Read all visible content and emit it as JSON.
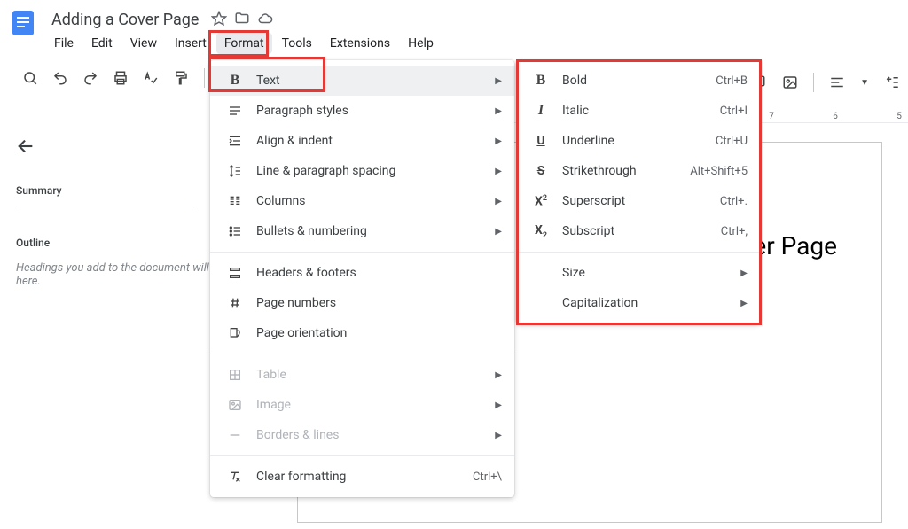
{
  "doc": {
    "title": "Adding a Cover Page"
  },
  "menubar": [
    "File",
    "Edit",
    "View",
    "Insert",
    "Format",
    "Tools",
    "Extensions",
    "Help"
  ],
  "ruler": {
    "labels": [
      "7",
      "6",
      "5"
    ]
  },
  "outline": {
    "summary_label": "Summary",
    "outline_label": "Outline",
    "help_text": "Headings you add to the document will appear here."
  },
  "page": {
    "visible_text": "ver Page"
  },
  "format_menu": {
    "text": "Text",
    "paragraph_styles": "Paragraph styles",
    "align_indent": "Align & indent",
    "line_spacing": "Line & paragraph spacing",
    "columns": "Columns",
    "bullets": "Bullets & numbering",
    "headers_footers": "Headers & footers",
    "page_numbers": "Page numbers",
    "page_orientation": "Page orientation",
    "table": "Table",
    "image": "Image",
    "borders_lines": "Borders & lines",
    "clear_formatting": "Clear formatting",
    "clear_shortcut": "Ctrl+\\"
  },
  "text_menu": {
    "bold": {
      "label": "Bold",
      "shortcut": "Ctrl+B"
    },
    "italic": {
      "label": "Italic",
      "shortcut": "Ctrl+I"
    },
    "underline": {
      "label": "Underline",
      "shortcut": "Ctrl+U"
    },
    "strike": {
      "label": "Strikethrough",
      "shortcut": "Alt+Shift+5"
    },
    "superscript": {
      "label": "Superscript",
      "shortcut": "Ctrl+."
    },
    "subscript": {
      "label": "Subscript",
      "shortcut": "Ctrl+,"
    },
    "size": "Size",
    "capitalization": "Capitalization"
  }
}
